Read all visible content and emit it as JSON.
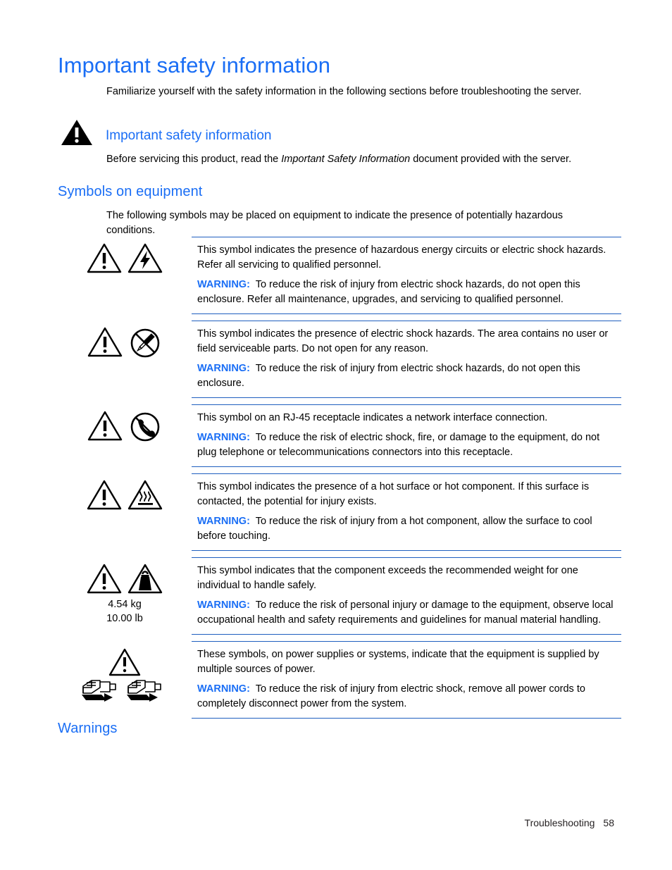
{
  "page": {
    "title": "Important safety information",
    "intro": "Familiarize yourself with the safety information in the following sections before troubleshooting the server.",
    "accent_color": "#1a6ef5",
    "rule_color": "#1f5fbf",
    "text_color": "#000000"
  },
  "important_callout": {
    "heading": "Important safety information",
    "icon": "warning-triangle-icon",
    "body_before": "Before servicing this product, read the ",
    "body_italic": "Important Safety Information",
    "body_after": " document provided with the server."
  },
  "symbols_section": {
    "heading": "Symbols on equipment",
    "intro": "The following symbols may be placed on equipment to indicate the presence of potentially hazardous conditions.",
    "warning_label": "WARNING:",
    "rows": [
      {
        "icons": [
          "warning-triangle-icon",
          "electric-shock-triangle-icon"
        ],
        "description": "This symbol indicates the presence of hazardous energy circuits or electric shock hazards. Refer all servicing to qualified personnel.",
        "warning": "To reduce the risk of injury from electric shock hazards, do not open this enclosure. Refer all maintenance, upgrades, and servicing to qualified personnel."
      },
      {
        "icons": [
          "warning-triangle-icon",
          "no-servicing-screwdriver-icon"
        ],
        "description": "This symbol indicates the presence of electric shock hazards. The area contains no user or field serviceable parts. Do not open for any reason.",
        "warning": "To reduce the risk of injury from electric shock hazards, do not open this enclosure."
      },
      {
        "icons": [
          "warning-triangle-icon",
          "no-telephone-icon"
        ],
        "description": "This symbol on an RJ-45 receptacle indicates a network interface connection.",
        "warning": "To reduce the risk of electric shock, fire, or damage to the equipment, do not plug telephone or telecommunications connectors into this receptacle."
      },
      {
        "icons": [
          "warning-triangle-icon",
          "hot-surface-triangle-icon"
        ],
        "description": "This symbol indicates the presence of a hot surface or hot component. If this surface is contacted, the potential for injury exists.",
        "warning": "To reduce the risk of injury from a hot component, allow the surface to cool before touching."
      },
      {
        "icons": [
          "warning-triangle-icon",
          "heavy-weight-triangle-icon"
        ],
        "weight_metric": "4.54 kg",
        "weight_imperial": "10.00 lb",
        "description": "This symbol indicates that the component exceeds the recommended weight for one individual to handle safely.",
        "warning": "To reduce the risk of personal injury or damage to the equipment, observe local occupational health and safety requirements and guidelines for manual material handling."
      },
      {
        "icons": [
          "warning-triangle-icon",
          "multiple-power-cords-icon"
        ],
        "description": "These symbols, on power supplies or systems, indicate that the equipment is supplied by multiple sources of power.",
        "warning": "To reduce the risk of injury from electric shock, remove all power cords to completely disconnect power from the system."
      }
    ]
  },
  "warnings_section": {
    "heading": "Warnings"
  },
  "footer": {
    "chapter": "Troubleshooting",
    "page_number": "58"
  }
}
